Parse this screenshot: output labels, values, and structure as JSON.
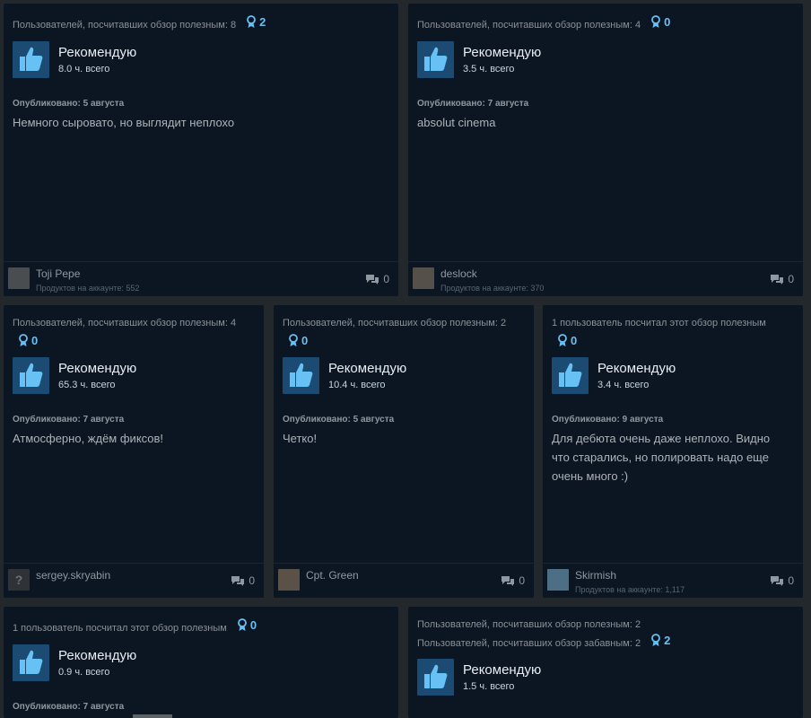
{
  "reviews": [
    {
      "helpful": "Пользователей, посчитавших обзор полезным: 8",
      "award_count": "2",
      "recommendation": "Рекомендую",
      "hours": "8.0 ч. всего",
      "posted": "Опубликовано: 5 августа",
      "text": "Немного сыровато, но выглядит неплохо",
      "author": "Toji Pepe",
      "products": "Продуктов на аккаунте: 552",
      "comments": "0"
    },
    {
      "helpful": "Пользователей, посчитавших обзор полезным: 4",
      "award_count": "0",
      "recommendation": "Рекомендую",
      "hours": "3.5 ч. всего",
      "posted": "Опубликовано: 7 августа",
      "text": "absolut cinema",
      "author": "deslock",
      "products": "Продуктов на аккаунте: 370",
      "comments": "0"
    },
    {
      "helpful": "Пользователей, посчитавших обзор полезным: 4",
      "award_count": "0",
      "recommendation": "Рекомендую",
      "hours": "65.3 ч. всего",
      "posted": "Опубликовано: 7 августа",
      "text": "Атмосферно, ждём фиксов!",
      "author": "sergey.skryabin",
      "comments": "0"
    },
    {
      "helpful": "Пользователей, посчитавших обзор полезным: 2",
      "award_count": "0",
      "recommendation": "Рекомендую",
      "hours": "10.4 ч. всего",
      "posted": "Опубликовано: 5 августа",
      "text": "Четко!",
      "author": "Cpt. Green",
      "comments": "0"
    },
    {
      "helpful": "1 пользователь посчитал этот обзор полезным",
      "award_count": "0",
      "recommendation": "Рекомендую",
      "hours": "3.4 ч. всего",
      "posted": "Опубликовано: 9 августа",
      "text_lines": [
        "Для дебюта очень даже неплохо. Видно",
        "что старались, но полировать надо еще",
        "очень много :)"
      ],
      "author": "Skirmish",
      "products": "Продуктов на аккаунте: 1,117",
      "comments": "0"
    },
    {
      "helpful": "1 пользователь посчитал этот обзор полезным",
      "award_count": "0",
      "recommendation": "Рекомендую",
      "hours": "0.9 ч. всего",
      "posted": "Опубликовано: 7 августа"
    },
    {
      "helpful": "Пользователей, посчитавших обзор полезным: 2",
      "funny": "Пользователей, посчитавших обзор забавным: 2",
      "award_count": "2",
      "recommendation": "Рекомендую",
      "hours": "1.5 ч. всего"
    }
  ],
  "colors": {
    "accent": "#66c0f4",
    "card_bg": "#0c1622",
    "page_bg": "#23282d",
    "thumb_bg": "#1b4a73"
  },
  "icons": [
    "award-icon",
    "thumbs-up-icon",
    "comments-icon",
    "avatar-placeholder-icon"
  ]
}
